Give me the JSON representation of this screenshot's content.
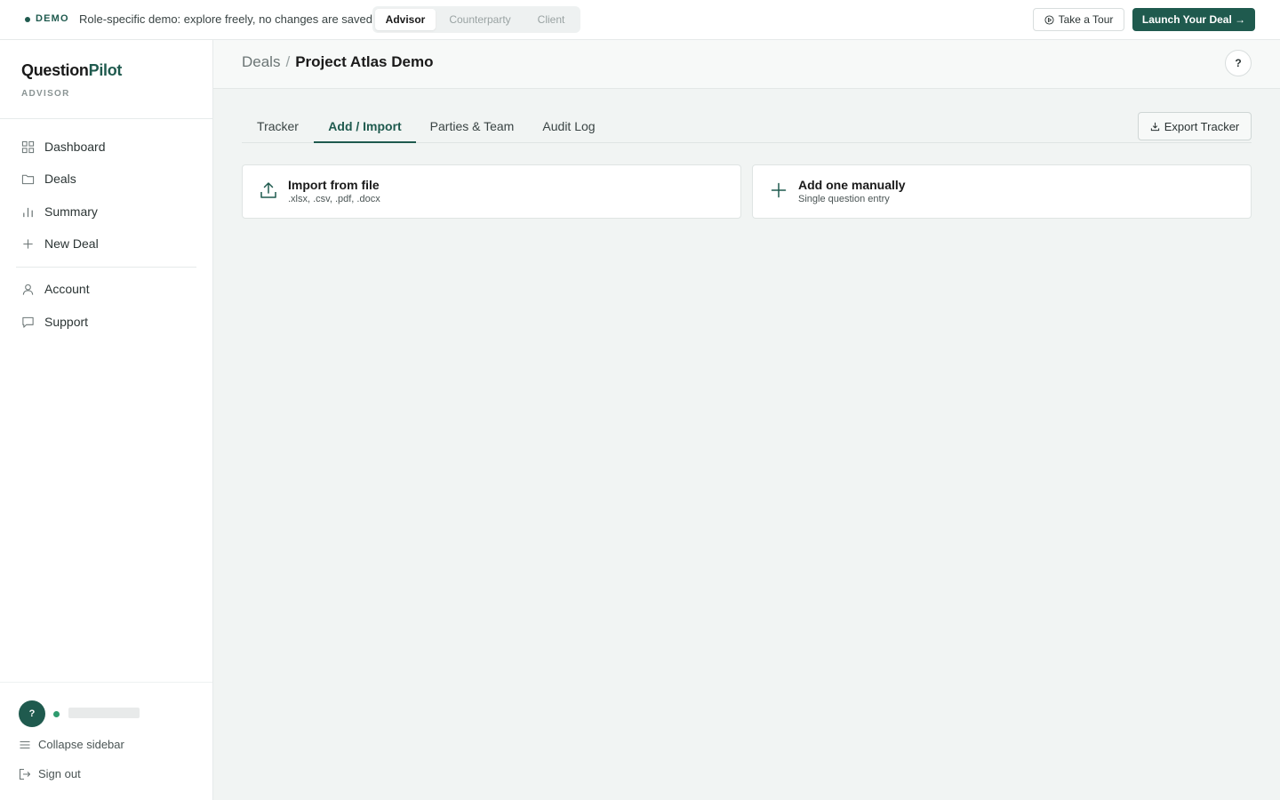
{
  "topbar": {
    "demo_label": "DEMO",
    "demo_message": "Role-specific demo: explore freely, no changes are saved.",
    "roles": [
      {
        "label": "Advisor",
        "active": true
      },
      {
        "label": "Counterparty",
        "active": false
      },
      {
        "label": "Client",
        "active": false
      }
    ],
    "tour_label": "Take a Tour",
    "launch_label": "Launch Your Deal →"
  },
  "sidebar": {
    "brand_part1": "Question",
    "brand_part2": "Pilot",
    "role_label": "ADVISOR",
    "primary_nav": [
      {
        "label": "Dashboard",
        "icon": "grid-icon"
      },
      {
        "label": "Deals",
        "icon": "folder-icon"
      },
      {
        "label": "Summary",
        "icon": "bar-chart-icon"
      },
      {
        "label": "New Deal",
        "icon": "plus-icon"
      }
    ],
    "secondary_nav": [
      {
        "label": "Account",
        "icon": "user-icon"
      },
      {
        "label": "Support",
        "icon": "message-icon"
      }
    ],
    "avatar_initial": "?",
    "collapse_label": "Collapse sidebar",
    "signout_label": "Sign out"
  },
  "header": {
    "breadcrumb_root": "Deals",
    "breadcrumb_sep": "/",
    "breadcrumb_current": "Project Atlas Demo",
    "help_label": "?"
  },
  "tabs": [
    {
      "label": "Tracker",
      "active": false
    },
    {
      "label": "Add / Import",
      "active": true
    },
    {
      "label": "Parties & Team",
      "active": false
    },
    {
      "label": "Audit Log",
      "active": false
    }
  ],
  "export_label": "Export Tracker",
  "cards": [
    {
      "title": "Import from file",
      "subtitle": ".xlsx, .csv, .pdf, .docx",
      "icon": "upload-icon"
    },
    {
      "title": "Add one manually",
      "subtitle": "Single question entry",
      "icon": "plus-icon"
    }
  ],
  "colors": {
    "accent": "#1f5a4e",
    "online": "#2e9b6e",
    "main_bg": "#f1f4f3"
  }
}
